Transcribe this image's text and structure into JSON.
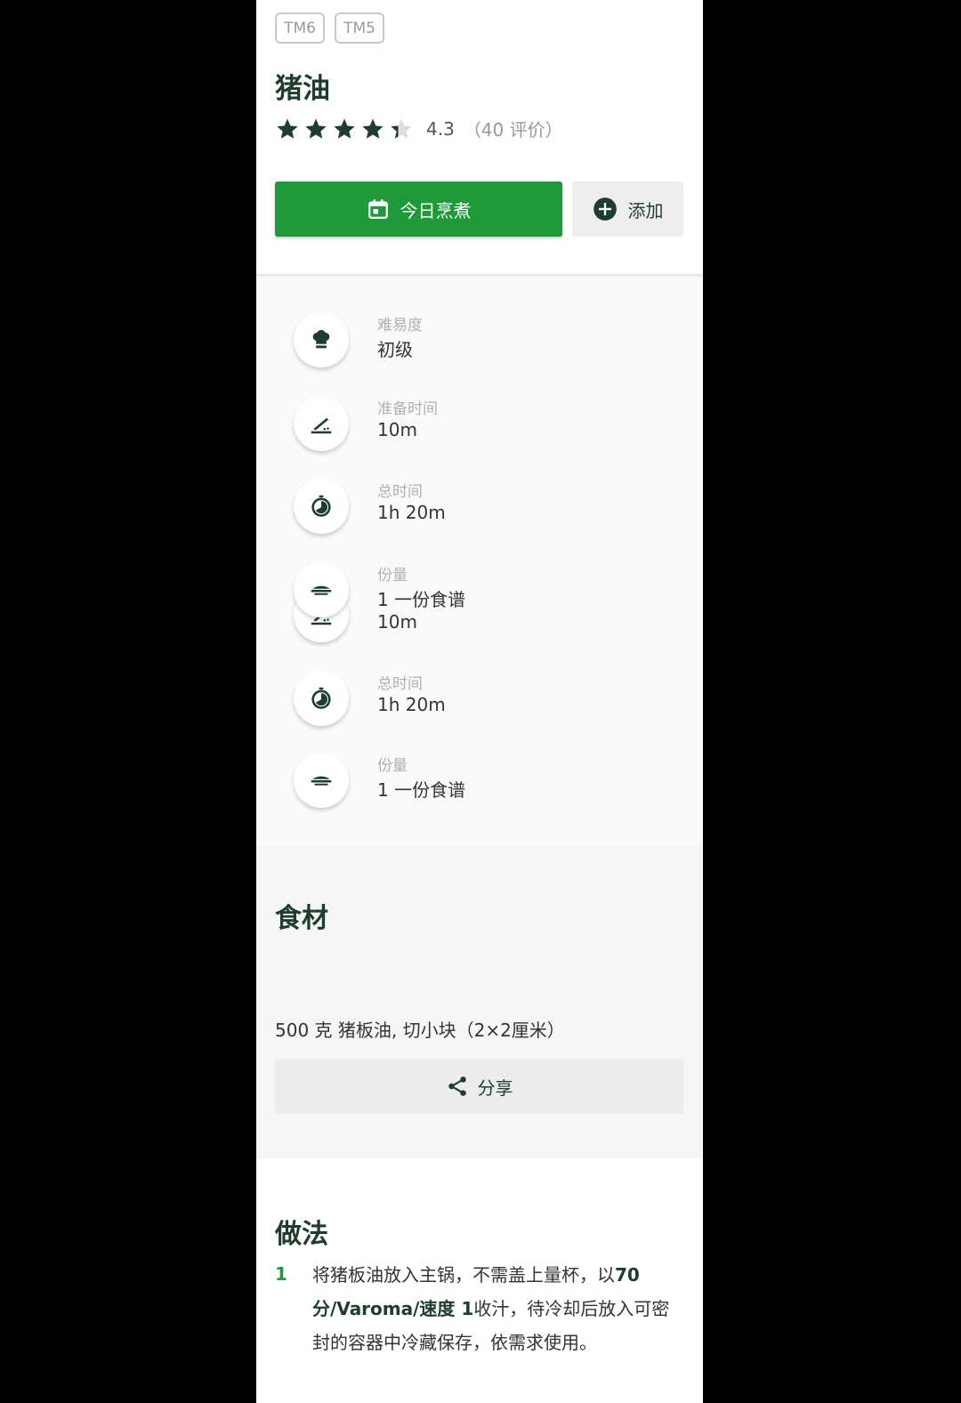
{
  "badges": [
    "TM6",
    "TM5"
  ],
  "recipe": {
    "title": "猪油",
    "rating_value": "4.3",
    "rating_count": "（40 评价）",
    "rating_stars": 4.3
  },
  "actions": {
    "cook_today": "今日烹煮",
    "add": "添加"
  },
  "info": [
    {
      "label": "难易度",
      "value": "初级",
      "icon": "chef-hat-icon"
    },
    {
      "label": "准备时间",
      "value": "10m",
      "icon": "knife-board-icon"
    },
    {
      "label": "总时间",
      "value": "1h 20m",
      "icon": "timer-icon"
    },
    {
      "label": "份量",
      "value": "1 一份食谱",
      "extra": "10m",
      "icon": "dish-icon"
    },
    {
      "label": "总时间",
      "value": "1h 20m",
      "icon": "timer-icon"
    },
    {
      "label": "份量",
      "value": "1 一份食谱",
      "icon": "dish-icon"
    }
  ],
  "ingredients": {
    "title": "食材",
    "items": [
      "500 克 猪板油, 切小块（2×2厘米）"
    ],
    "share": "分享"
  },
  "method": {
    "title": "做法",
    "steps": [
      {
        "num": "1",
        "text_a": "将猪板油放入主锅，不需盖上量杯，以",
        "text_bold": "70 分/Varoma/速度 1",
        "text_b": "收汁，待冷却后放入可密封的容器中冷藏保存，依需求使用。"
      }
    ]
  },
  "colors": {
    "brand_green": "#1f9a3a",
    "dark_green": "#1f3d2c"
  }
}
